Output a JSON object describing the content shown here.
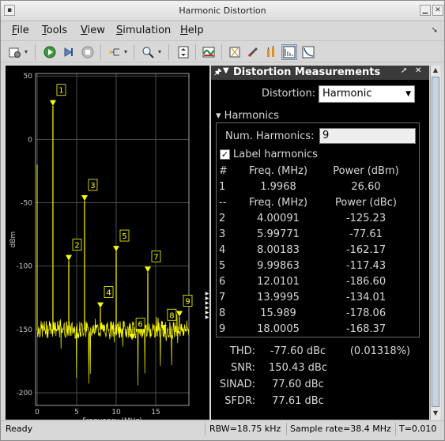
{
  "window": {
    "title": "Harmonic Distortion"
  },
  "menubar": {
    "items": [
      "File",
      "Tools",
      "View",
      "Simulation",
      "Help"
    ],
    "mnemonics": [
      "F",
      "T",
      "V",
      "S",
      "H"
    ]
  },
  "toolbar": {
    "icons": [
      "settings-icon",
      "run-icon",
      "step-forward-icon",
      "stop-icon",
      "signal-select-icon",
      "zoom-icon",
      "scale-axes-icon",
      "spectrum-settings-icon",
      "cursor-measurements-icon",
      "signal-statistics-icon",
      "peak-finder-icon",
      "distortion-measurements-icon",
      "ccdf-icon"
    ]
  },
  "plot": {
    "ylabel": "dBm",
    "xlabel": "Frequency (MHz)",
    "yticks": [
      50,
      0,
      -50,
      -100,
      -150,
      -200
    ],
    "xticks": [
      0,
      5,
      10,
      15
    ],
    "colors": {
      "trace": "#ffff00",
      "grid": "#4d4d4d",
      "axes": "#c8c8c8",
      "background": "#000000"
    }
  },
  "chart_data": {
    "type": "line",
    "xlabel": "Frequency (MHz)",
    "ylabel": "dBm",
    "xlim": [
      -0.2,
      19.2
    ],
    "ylim": [
      -210,
      52
    ],
    "noise_floor": -150,
    "series": [
      {
        "name": "Spectrum",
        "peaks": [
          {
            "label": "1",
            "x": 1.9968,
            "y": 26.6
          },
          {
            "label": "2",
            "x": 4.00091,
            "y": -95.6
          },
          {
            "label": "3",
            "x": 5.99771,
            "y": -48.4
          },
          {
            "label": "4",
            "x": 8.00183,
            "y": -133.0
          },
          {
            "label": "5",
            "x": 9.99863,
            "y": -88.4
          },
          {
            "label": "6",
            "x": 12.0101,
            "y": -158.0
          },
          {
            "label": "7",
            "x": 13.9995,
            "y": -104.8
          },
          {
            "label": "8",
            "x": 15.989,
            "y": -150.9
          },
          {
            "label": "9",
            "x": 18.0005,
            "y": -139.8
          }
        ]
      }
    ],
    "grid": true
  },
  "measurements": {
    "title": "Distortion Measurements",
    "distortion_label": "Distortion:",
    "distortion_value": "Harmonic",
    "harmonics_section": "Harmonics",
    "num_harmonics_label": "Num. Harmonics:",
    "num_harmonics_value": "9",
    "label_harmonics": "Label harmonics",
    "label_harmonics_checked": true,
    "table_header": [
      "#",
      "Freq. (MHz)",
      "Power (dBm)"
    ],
    "fundamental": [
      "1",
      "1.9968",
      "26.60"
    ],
    "sub_header": [
      "--",
      "Freq. (MHz)",
      "Power (dBc)"
    ],
    "rows": [
      [
        "2",
        "4.00091",
        "-125.23"
      ],
      [
        "3",
        "5.99771",
        "-77.61"
      ],
      [
        "4",
        "8.00183",
        "-162.17"
      ],
      [
        "5",
        "9.99863",
        "-117.43"
      ],
      [
        "6",
        "12.0101",
        "-186.60"
      ],
      [
        "7",
        "13.9995",
        "-134.01"
      ],
      [
        "8",
        "15.989",
        "-178.06"
      ],
      [
        "9",
        "18.0005",
        "-168.37"
      ]
    ],
    "stats": [
      {
        "key": "THD:",
        "value": "-77.60 dBc",
        "extra": "(0.01318%)"
      },
      {
        "key": "SNR:",
        "value": "150.43 dBc",
        "extra": ""
      },
      {
        "key": "SINAD:",
        "value": "77.60 dBc",
        "extra": ""
      },
      {
        "key": "SFDR:",
        "value": "77.61 dBc",
        "extra": ""
      }
    ]
  },
  "statusbar": {
    "status": "Ready",
    "rbw": "RBW=18.75 kHz",
    "sample_rate": "Sample rate=38.4 MHz",
    "time": "T=0.010"
  }
}
